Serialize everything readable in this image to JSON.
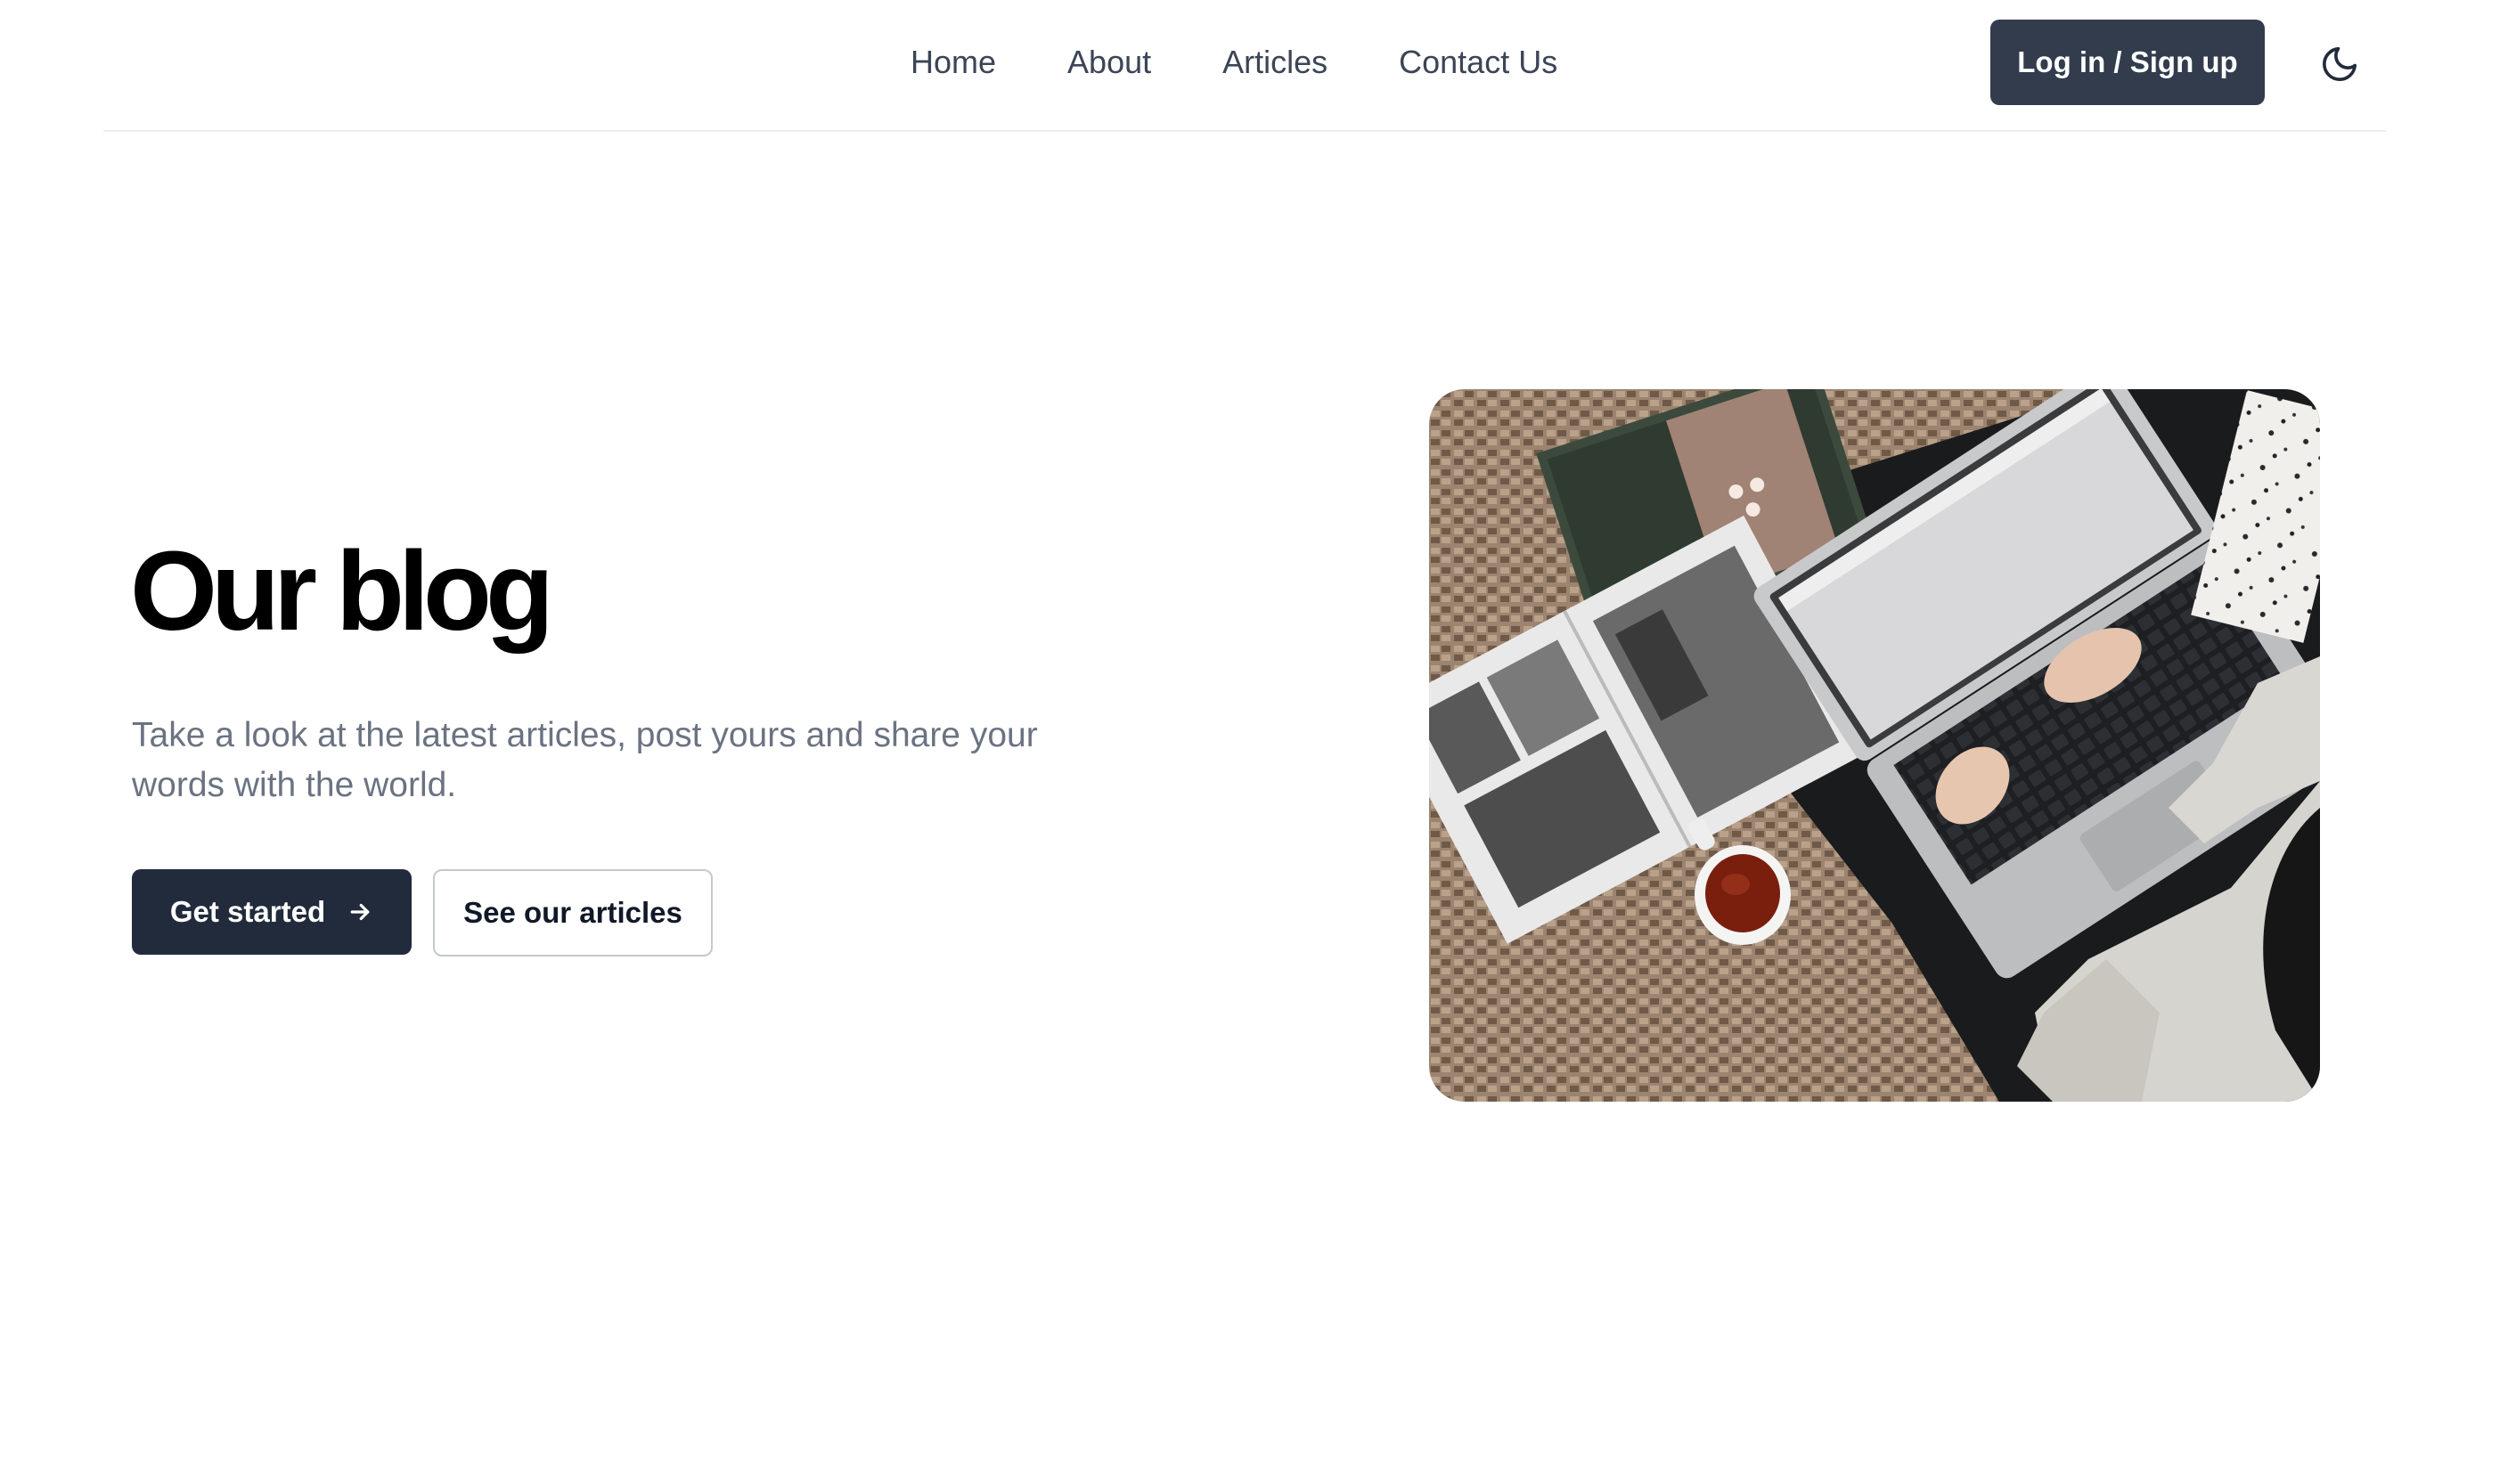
{
  "nav": {
    "items": [
      {
        "label": "Home"
      },
      {
        "label": "About"
      },
      {
        "label": "Articles"
      },
      {
        "label": "Contact Us"
      }
    ],
    "login_label": "Log in / Sign up",
    "theme_icon": "moon-icon"
  },
  "hero": {
    "title": "Our blog",
    "subtitle": "Take a look at the latest articles, post yours and share your words with the world.",
    "primary_button": "Get started",
    "primary_icon": "arrow-right-icon",
    "secondary_button": "See our articles",
    "image": {
      "alt": "Person working on a laptop with a magazine and a cup of tea on a woven rug"
    }
  },
  "colors": {
    "primary": "#222b3b",
    "login_button": "#323c4d",
    "nav_text": "#3b4556",
    "subtitle_text": "#6b7382",
    "divider": "#eceef1"
  }
}
